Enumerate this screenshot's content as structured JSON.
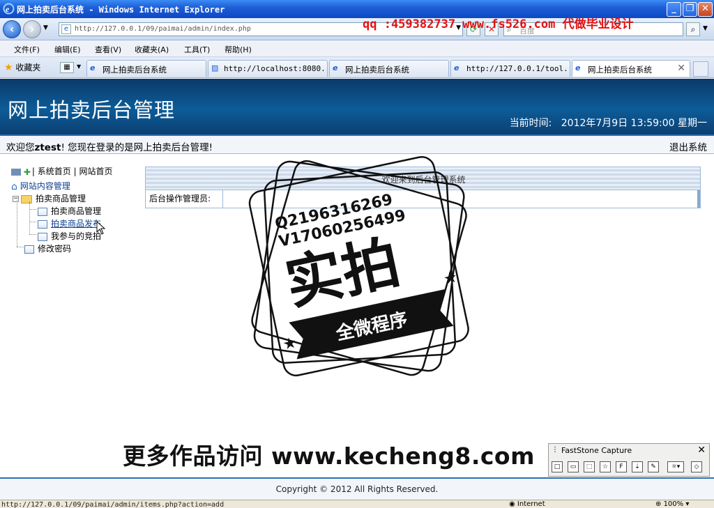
{
  "window": {
    "title": "网上拍卖后台系统 - Windows Internet Explorer",
    "min_label": "_",
    "max_label": "❐",
    "close_label": "✕"
  },
  "address": {
    "url": "http://127.0.0.1/09/paimai/admin/index.php",
    "search_placeholder": "百度",
    "overlay_ad": "qq :459382737 www.fs526.com 代做毕业设计"
  },
  "menu": [
    "文件(F)",
    "编辑(E)",
    "查看(V)",
    "收藏夹(A)",
    "工具(T)",
    "帮助(H)"
  ],
  "favorites_label": "收藏夹",
  "tabs": [
    {
      "label": "网上拍卖后台系统",
      "active": false
    },
    {
      "label": "http://localhost:8080...",
      "active": false
    },
    {
      "label": "网上拍卖后台系统",
      "active": false
    },
    {
      "label": "http://127.0.0.1/tool...",
      "active": false
    },
    {
      "label": "网上拍卖后台系统",
      "active": true
    }
  ],
  "header": {
    "title": "网上拍卖后台管理",
    "time_label": "当前时间:",
    "time_value": "2012年7月9日 13:59:00 星期一"
  },
  "welcome": {
    "prefix": "欢迎您",
    "user": "ztest",
    "suffix": "! 您现在登录的是网上拍卖后台管理!",
    "logout": "退出系统"
  },
  "sidebar": {
    "top_links": [
      "系统首页",
      "网站首页"
    ],
    "root": "网站内容管理",
    "group": "拍卖商品管理",
    "items": [
      "拍卖商品管理",
      "拍卖商品发布",
      "我参与的竞拍"
    ],
    "change_password": "修改密码"
  },
  "main": {
    "panel_title": "欢迎来到后台管理系统",
    "row_label": "后台操作管理员:"
  },
  "footer": {
    "copyright": "Copyright © 2012 All Rights Reserved."
  },
  "stamp": {
    "line1": "Q2196316269",
    "line2": "V17060256499",
    "big": "实拍",
    "banner": "全微程序"
  },
  "overlay_bottom": "更多作品访问 www.kecheng8.com",
  "faststone": {
    "title": "FastStone Capture",
    "close": "✕"
  },
  "status": {
    "url": "http://127.0.0.1/09/paimai/admin/items.php?action=add",
    "zone": "Internet",
    "zoom": "100%"
  }
}
